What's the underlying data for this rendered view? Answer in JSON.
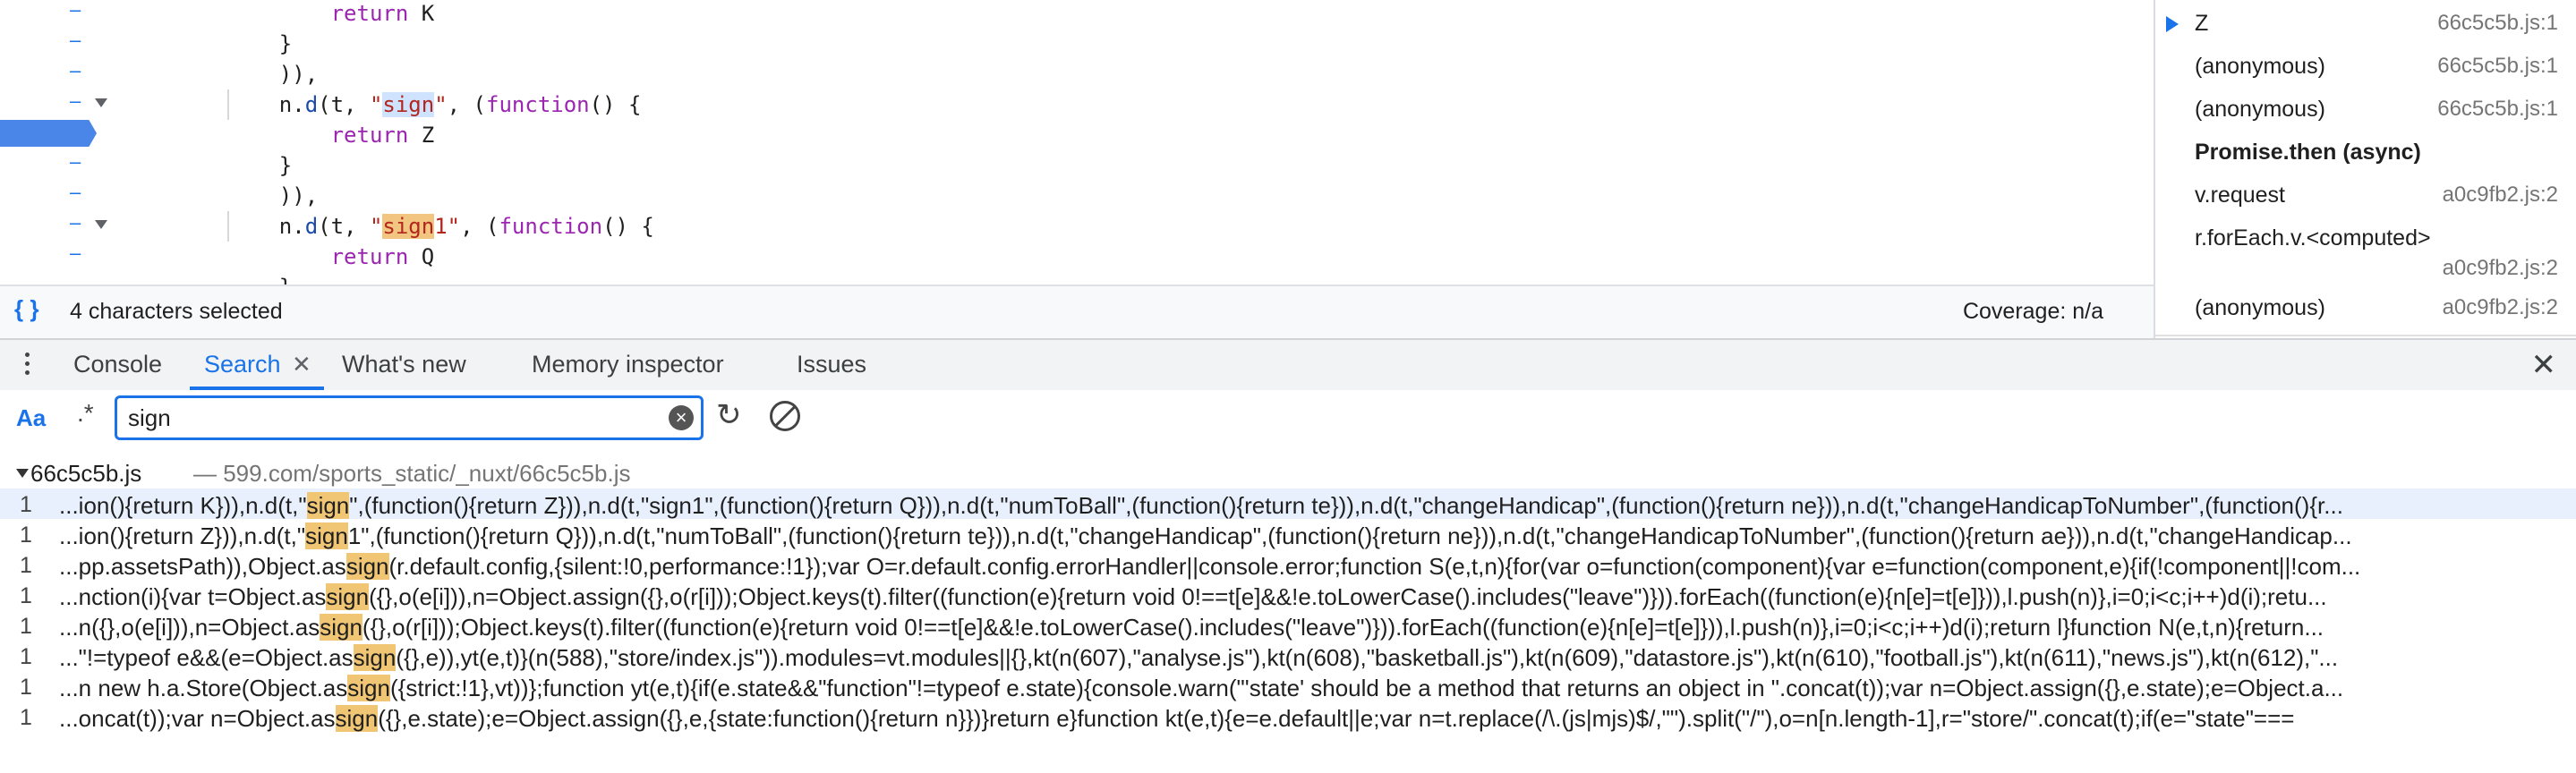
{
  "editor": {
    "lines": [
      {
        "indent": "        ",
        "tokens": [
          {
            "t": "return",
            "c": "kw"
          },
          {
            "t": " K",
            "c": ""
          }
        ],
        "dash": true,
        "fold": false
      },
      {
        "indent": "    ",
        "tokens": [
          {
            "t": "}",
            "c": ""
          }
        ],
        "dash": true,
        "fold": false
      },
      {
        "indent": "    ",
        "tokens": [
          {
            "t": ")),",
            "c": ""
          }
        ],
        "dash": true,
        "fold": false
      },
      {
        "indent": "    ",
        "tokens": [
          {
            "t": "n.",
            "c": ""
          },
          {
            "t": "d",
            "c": "fn"
          },
          {
            "t": "(t, ",
            "c": ""
          },
          {
            "t": "\"",
            "c": "str"
          },
          {
            "t": "sign",
            "c": "str hl-sel"
          },
          {
            "t": "\"",
            "c": "str"
          },
          {
            "t": ", (",
            "c": ""
          },
          {
            "t": "function",
            "c": "kw"
          },
          {
            "t": "() {",
            "c": ""
          }
        ],
        "dash": true,
        "fold": true
      },
      {
        "indent": "        ",
        "tokens": [
          {
            "t": "return",
            "c": "kw"
          },
          {
            "t": " Z",
            "c": ""
          }
        ],
        "dash": false,
        "fold": false,
        "breakpoint": true
      },
      {
        "indent": "    ",
        "tokens": [
          {
            "t": "}",
            "c": ""
          }
        ],
        "dash": true,
        "fold": false
      },
      {
        "indent": "    ",
        "tokens": [
          {
            "t": ")),",
            "c": ""
          }
        ],
        "dash": true,
        "fold": false
      },
      {
        "indent": "    ",
        "tokens": [
          {
            "t": "n.",
            "c": ""
          },
          {
            "t": "d",
            "c": "fn"
          },
          {
            "t": "(t, ",
            "c": ""
          },
          {
            "t": "\"",
            "c": "str"
          },
          {
            "t": "sign",
            "c": "str hl-find"
          },
          {
            "t": "1\"",
            "c": "str"
          },
          {
            "t": ", (",
            "c": ""
          },
          {
            "t": "function",
            "c": "kw"
          },
          {
            "t": "() {",
            "c": ""
          }
        ],
        "dash": true,
        "fold": true
      },
      {
        "indent": "        ",
        "tokens": [
          {
            "t": "return",
            "c": "kw"
          },
          {
            "t": " Q",
            "c": ""
          }
        ],
        "dash": true,
        "fold": false
      },
      {
        "indent": "    ",
        "tokens": [
          {
            "t": "}",
            "c": ""
          }
        ],
        "dash": false,
        "fold": false
      }
    ]
  },
  "status": {
    "braces": "{ }",
    "selection": "4 characters selected",
    "coverage": "Coverage: n/a"
  },
  "callstack": [
    {
      "name": "Z",
      "loc": "66c5c5b.js:1",
      "active": true
    },
    {
      "name": "(anonymous)",
      "loc": "66c5c5b.js:1"
    },
    {
      "name": "(anonymous)",
      "loc": "66c5c5b.js:1"
    },
    {
      "name": "Promise.then (async)",
      "loc": "",
      "async": true
    },
    {
      "name": "v.request",
      "loc": "a0c9fb2.js:2"
    },
    {
      "name": "r.forEach.v.<computed>",
      "loc": "a0c9fb2.js:2",
      "wrap": true
    },
    {
      "name": "(anonymous)",
      "loc": "a0c9fb2.js:2"
    }
  ],
  "drawer": {
    "tabs": [
      {
        "label": "Console"
      },
      {
        "label": "Search",
        "active": true,
        "closable": true
      },
      {
        "label": "What's new"
      },
      {
        "label": "Memory inspector"
      },
      {
        "label": "Issues"
      }
    ],
    "close_glyph": "✕"
  },
  "search": {
    "case_label": "Aa",
    "regex_label": ".*",
    "query": "sign",
    "placeholder": "Search"
  },
  "results": {
    "file_name": "66c5c5b.js",
    "file_path": "— 599.com/sports_static/_nuxt/66c5c5b.js",
    "rows": [
      {
        "num": "1",
        "pre": "...ion(){return K})),n.d(t,\"",
        "match": "sign",
        "post": "\",(function(){return Z})),n.d(t,\"sign1\",(function(){return Q})),n.d(t,\"numToBall\",(function(){return te})),n.d(t,\"changeHandicap\",(function(){return ne})),n.d(t,\"changeHandicapToNumber\",(function(){r...",
        "selected": true
      },
      {
        "num": "1",
        "pre": "...ion(){return Z})),n.d(t,\"",
        "match": "sign",
        "post": "1\",(function(){return Q})),n.d(t,\"numToBall\",(function(){return te})),n.d(t,\"changeHandicap\",(function(){return ne})),n.d(t,\"changeHandicapToNumber\",(function(){return ae})),n.d(t,\"changeHandicap..."
      },
      {
        "num": "1",
        "pre": "...pp.assetsPath)),Object.as",
        "match": "sign",
        "post": "(r.default.config,{silent:!0,performance:!1});var O=r.default.config.errorHandler||console.error;function S(e,t,n){for(var o=function(component){var e=function(component,e){if(!component||!com..."
      },
      {
        "num": "1",
        "pre": "...nction(i){var t=Object.as",
        "match": "sign",
        "post": "({},o(e[i])),n=Object.assign({},o(r[i]));Object.keys(t).filter((function(e){return void 0!==t[e]&&!e.toLowerCase().includes(\"leave\")})).forEach((function(e){n[e]=t[e]})),l.push(n)},i=0;i<c;i++)d(i);retu..."
      },
      {
        "num": "1",
        "pre": "...n({},o(e[i])),n=Object.as",
        "match": "sign",
        "post": "({},o(r[i]));Object.keys(t).filter((function(e){return void 0!==t[e]&&!e.toLowerCase().includes(\"leave\")})).forEach((function(e){n[e]=t[e]})),l.push(n)},i=0;i<c;i++)d(i);return l}function N(e,t,n){return..."
      },
      {
        "num": "1",
        "pre": "...\"!=typeof e&&(e=Object.as",
        "match": "sign",
        "post": "({},e)),yt(e,t)}(n(588),\"store/index.js\")).modules=vt.modules||{},kt(n(607),\"analyse.js\"),kt(n(608),\"basketball.js\"),kt(n(609),\"datastore.js\"),kt(n(610),\"football.js\"),kt(n(611),\"news.js\"),kt(n(612),\"..."
      },
      {
        "num": "1",
        "pre": "...n new h.a.Store(Object.as",
        "match": "sign",
        "post": "({strict:!1},vt))};function yt(e,t){if(e.state&&\"function\"!=typeof e.state){console.warn(\"'state' should be a method that returns an object in \".concat(t));var n=Object.assign({},e.state);e=Object.a..."
      },
      {
        "num": "1",
        "pre": "...oncat(t));var n=Object.as",
        "match": "sign",
        "post": "({},e.state);e=Object.assign({},e,{state:function(){return n}})}return e}function kt(e,t){e=e.default||e;var n=t.replace(/\\.(js|mjs)$/,\"\").split(\"/\"),o=n[n.length-1],r=\"store/\".concat(t);if(e=\"state\"==="
      }
    ]
  }
}
